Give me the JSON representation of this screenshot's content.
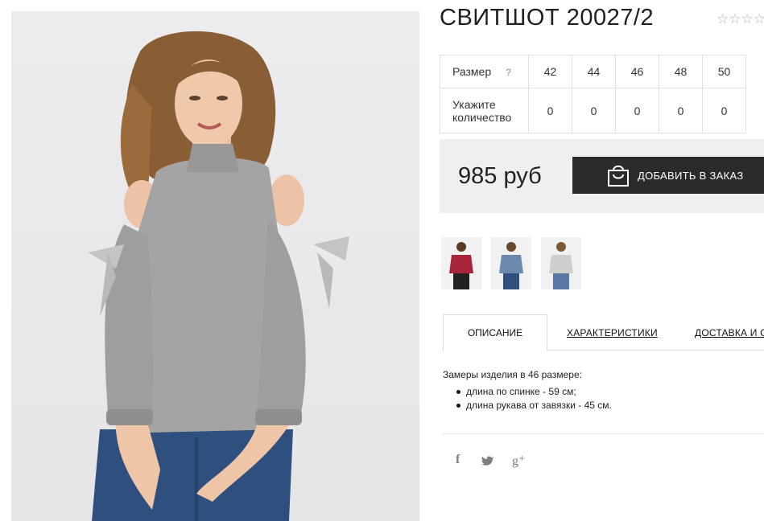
{
  "product": {
    "title": "СВИТШОТ 20027/2",
    "rating_stars": "☆☆☆☆"
  },
  "sizes": {
    "header_label": "Размер",
    "help_mark": "?",
    "quantity_label": "Укажите количество",
    "items": [
      {
        "size": "42",
        "qty": "0"
      },
      {
        "size": "44",
        "qty": "0"
      },
      {
        "size": "46",
        "qty": "0"
      },
      {
        "size": "48",
        "qty": "0"
      },
      {
        "size": "50",
        "qty": "0"
      }
    ]
  },
  "price": {
    "amount": "985 руб",
    "order_button": "ДОБАВИТЬ В ЗАКАЗ"
  },
  "colors": {
    "accent_dark": "#2b2b2b",
    "price_bg": "#efefef",
    "sweater_gray": "#a4a4a4",
    "jeans_blue": "#2f4f7f",
    "thumb_red": "#a8243a",
    "thumb_blue": "#6b89ab",
    "thumb_light": "#cfcfcf"
  },
  "tabs": [
    {
      "label": "ОПИСАНИЕ",
      "active": true
    },
    {
      "label": "ХАРАКТЕРИСТИКИ",
      "active": false
    },
    {
      "label": "ДОСТАВКА И О",
      "active": false
    }
  ],
  "description": {
    "intro": "Замеры изделия в 46 размере:",
    "items": [
      "длина по спинке - 59 см;",
      "длина рукава от завязки - 45 см."
    ]
  },
  "social": {
    "facebook": "f",
    "twitter": "🐦",
    "gplus": "g⁺"
  },
  "icons": {
    "bag": "shopping-bag-icon",
    "star": "star-outline-icon"
  }
}
